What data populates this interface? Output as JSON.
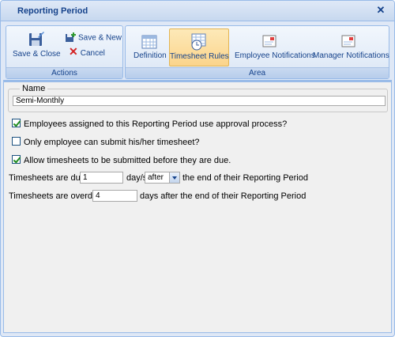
{
  "window": {
    "title": "Reporting Period"
  },
  "toolbar": {
    "save_close_label": "Save & Close",
    "save_new_label": "Save & New",
    "cancel_label": "Cancel",
    "actions_group_label": "Actions",
    "area_group_label": "Area",
    "tabs": [
      {
        "label": "Definition",
        "icon": "calendar-icon",
        "active": false
      },
      {
        "label": "Timesheet Rules",
        "icon": "timesheet-clock-icon",
        "active": true
      },
      {
        "label": "Employee Notifications",
        "icon": "notification-icon",
        "active": false
      },
      {
        "label": "Manager Notifications",
        "icon": "notification-icon",
        "active": false
      }
    ]
  },
  "name_section": {
    "legend": "Name",
    "value": "Semi-Monthly"
  },
  "options": {
    "approval_process": {
      "label": "Employees assigned to this Reporting Period use approval process?",
      "checked": true
    },
    "only_employee_submit": {
      "label": "Only employee can submit his/her timesheet?",
      "checked": false
    },
    "allow_before_due": {
      "label": "Allow timesheets to be submitted before they are due.",
      "checked": true
    }
  },
  "due_rule": {
    "prefix": "Timesheets are due",
    "value": "1",
    "unit": "day/s",
    "when_selected": "after",
    "suffix": "the end of their Reporting Period"
  },
  "overdue_rule": {
    "prefix": "Timesheets are overdue",
    "value": "4",
    "suffix": "days after the end of their Reporting Period"
  },
  "colors": {
    "title_text": "#15428b",
    "frame_border": "#99bbe8",
    "active_tab": "#fbd48b",
    "check_mark": "#1f8c1f"
  }
}
